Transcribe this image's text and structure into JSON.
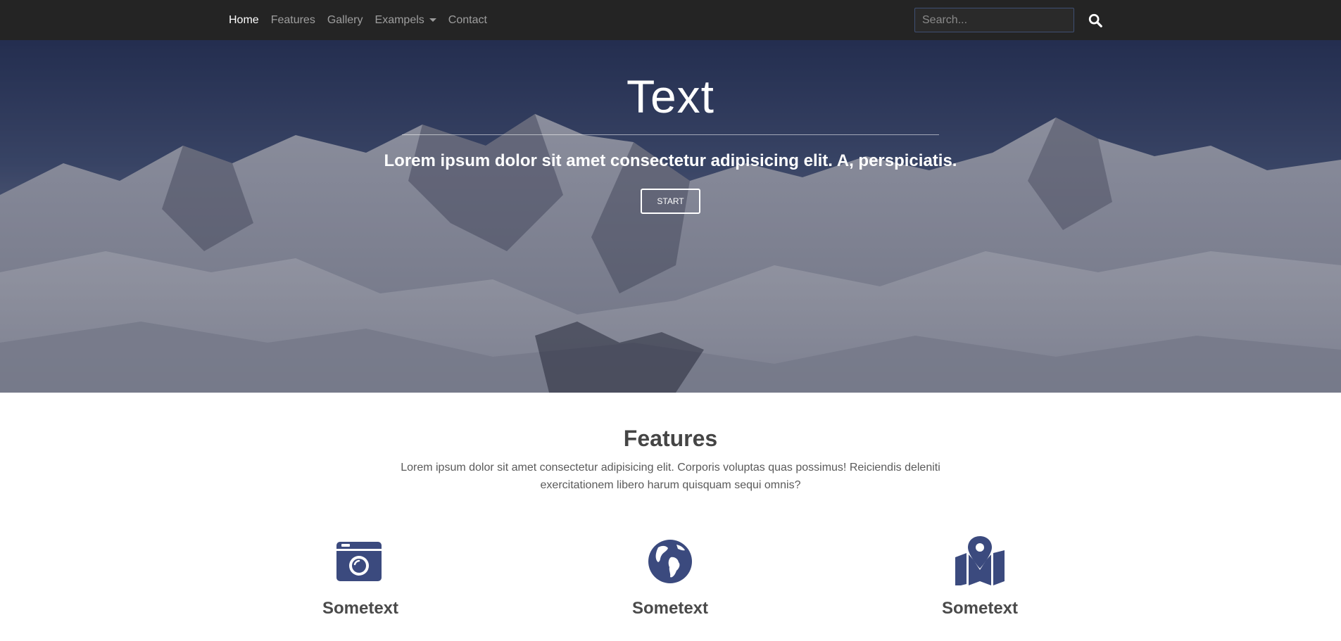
{
  "nav": {
    "links": [
      {
        "label": "Home",
        "active": true
      },
      {
        "label": "Features",
        "active": false
      },
      {
        "label": "Gallery",
        "active": false
      },
      {
        "label": "Exampels",
        "active": false,
        "dropdown": true
      },
      {
        "label": "Contact",
        "active": false
      }
    ],
    "search": {
      "placeholder": "Search...",
      "value": "",
      "icon": "search-icon"
    }
  },
  "hero": {
    "title": "Text",
    "subtitle": "Lorem ipsum dolor sit amet consectetur adipisicing elit. A, perspiciatis.",
    "button_label": "START"
  },
  "features": {
    "title": "Features",
    "description": "Lorem ipsum dolor sit amet consectetur adipisicing elit. Corporis voluptas quas possimus! Reiciendis deleniti exercitationem libero harum quisquam sequi omnis?",
    "items": [
      {
        "icon": "camera-icon",
        "title": "Sometext"
      },
      {
        "icon": "globe-icon",
        "title": "Sometext"
      },
      {
        "icon": "map-marker-icon",
        "title": "Sometext"
      }
    ]
  },
  "colors": {
    "navbar_bg": "#242424",
    "accent": "#3b4a7e",
    "text_dark": "#454545"
  }
}
